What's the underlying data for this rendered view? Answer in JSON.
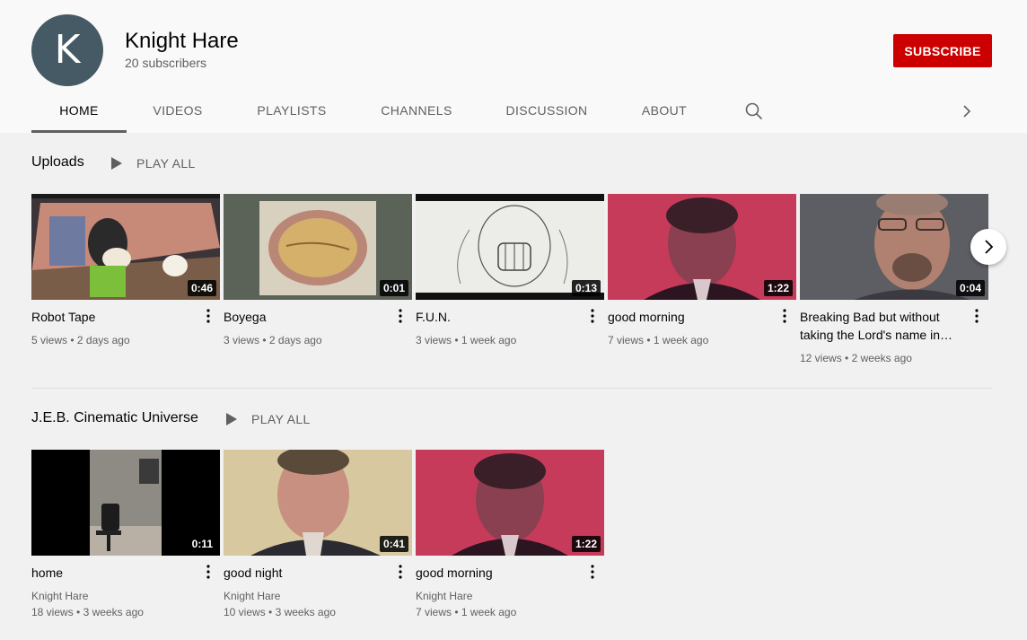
{
  "channel": {
    "avatar_letter": "K",
    "name": "Knight Hare",
    "subscribers": "20 subscribers",
    "subscribe_label": "SUBSCRIBE"
  },
  "tabs": [
    {
      "label": "HOME",
      "active": true
    },
    {
      "label": "VIDEOS"
    },
    {
      "label": "PLAYLISTS"
    },
    {
      "label": "CHANNELS"
    },
    {
      "label": "DISCUSSION"
    },
    {
      "label": "ABOUT"
    }
  ],
  "icons": {
    "search": "search-icon",
    "tabs_next": "chevron-right-icon",
    "shelf_next": "chevron-right-icon",
    "play": "play-icon",
    "more": "more-vert-icon"
  },
  "colors": {
    "subscribe": "#cc0000",
    "avatar": "#455a64"
  },
  "shelves": [
    {
      "title": "Uploads",
      "play_all": "PLAY ALL",
      "videos": [
        {
          "title": "Robot Tape",
          "duration": "0:46",
          "views": "5 views",
          "age": "2 days ago"
        },
        {
          "title": "Boyega",
          "duration": "0:01",
          "views": "3 views",
          "age": "2 days ago"
        },
        {
          "title": "F.U.N.",
          "duration": "0:13",
          "views": "3 views",
          "age": "1 week ago"
        },
        {
          "title": "good morning",
          "duration": "1:22",
          "views": "7 views",
          "age": "1 week ago"
        },
        {
          "title": "Breaking Bad but without taking the Lord's name in…",
          "duration": "0:04",
          "views": "12 views",
          "age": "2 weeks ago"
        }
      ]
    },
    {
      "title": "J.E.B. Cinematic Universe",
      "play_all": "PLAY ALL",
      "videos": [
        {
          "title": "home",
          "duration": "0:11",
          "channel": "Knight Hare",
          "views": "18 views",
          "age": "3 weeks ago"
        },
        {
          "title": "good night",
          "duration": "0:41",
          "channel": "Knight Hare",
          "views": "10 views",
          "age": "3 weeks ago"
        },
        {
          "title": "good morning",
          "duration": "1:22",
          "channel": "Knight Hare",
          "views": "7 views",
          "age": "1 week ago"
        }
      ]
    }
  ]
}
